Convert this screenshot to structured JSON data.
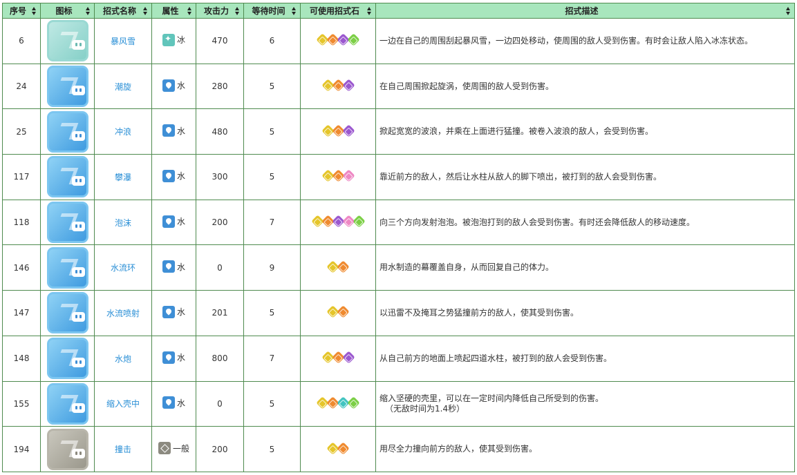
{
  "headers": [
    "序号",
    "图标",
    "招式名称",
    "属性",
    "攻击力",
    "等待时间",
    "可使用招式石",
    "招式描述"
  ],
  "rows": [
    {
      "id": "6",
      "name": "暴风雪",
      "attr": "冰",
      "attr_type": "ice",
      "attack": "470",
      "wait": "6",
      "stones": [
        "yellow",
        "orange",
        "purple",
        "green"
      ],
      "desc": "一边在自己的周围刮起暴风雪，一边四处移动，使周围的敌人受到伤害。有时会让敌人陷入冰冻状态。",
      "note": "",
      "icon": "ice-wave-icon"
    },
    {
      "id": "24",
      "name": "潮旋",
      "attr": "水",
      "attr_type": "water",
      "attack": "280",
      "wait": "5",
      "stones": [
        "yellow",
        "orange",
        "purple"
      ],
      "desc": "在自己周围掀起旋涡，使周围的敌人受到伤害。",
      "note": "",
      "icon": "whirlpool-icon"
    },
    {
      "id": "25",
      "name": "冲浪",
      "attr": "水",
      "attr_type": "water",
      "attack": "480",
      "wait": "5",
      "stones": [
        "yellow",
        "orange",
        "purple"
      ],
      "desc": "掀起宽宽的波浪，并乘在上面进行猛撞。被卷入波浪的敌人，会受到伤害。",
      "note": "",
      "icon": "surf-icon"
    },
    {
      "id": "117",
      "name": "攀瀑",
      "attr": "水",
      "attr_type": "water",
      "attack": "300",
      "wait": "5",
      "stones": [
        "yellow",
        "orange",
        "pink"
      ],
      "desc": "靠近前方的敌人，然后让水柱从敌人的脚下喷出，被打到的敌人会受到伤害。",
      "note": "",
      "icon": "waterfall-icon"
    },
    {
      "id": "118",
      "name": "泡沫",
      "attr": "水",
      "attr_type": "water",
      "attack": "200",
      "wait": "7",
      "stones": [
        "yellow",
        "orange",
        "purple",
        "pink",
        "green"
      ],
      "desc": "向三个方向发射泡泡。被泡泡打到的敌人会受到伤害。有时还会降低敌人的移动速度。",
      "note": "",
      "icon": "bubble-icon"
    },
    {
      "id": "146",
      "name": "水流环",
      "attr": "水",
      "attr_type": "water",
      "attack": "0",
      "wait": "9",
      "stones": [
        "yellow",
        "orange"
      ],
      "desc": "用水制造的幕覆盖自身，从而回复自己的体力。",
      "note": "",
      "icon": "aqua-ring-icon"
    },
    {
      "id": "147",
      "name": "水流喷射",
      "attr": "水",
      "attr_type": "water",
      "attack": "201",
      "wait": "5",
      "stones": [
        "yellow",
        "orange"
      ],
      "desc": "以迅雷不及掩耳之势猛撞前方的敌人，使其受到伤害。",
      "note": "",
      "icon": "aqua-jet-icon"
    },
    {
      "id": "148",
      "name": "水炮",
      "attr": "水",
      "attr_type": "water",
      "attack": "800",
      "wait": "7",
      "stones": [
        "yellow",
        "orange",
        "purple"
      ],
      "desc": "从自己前方的地面上喷起四道水柱，被打到的敌人会受到伤害。",
      "note": "",
      "icon": "hydro-pump-icon"
    },
    {
      "id": "155",
      "name": "缩入壳中",
      "attr": "水",
      "attr_type": "water",
      "attack": "0",
      "wait": "5",
      "stones": [
        "yellow",
        "orange",
        "cyan",
        "green"
      ],
      "desc": "缩入坚硬的壳里，可以在一定时间内降低自己所受到的伤害。",
      "note": "（无敌时间为1.4秒）",
      "icon": "withdraw-icon"
    },
    {
      "id": "194",
      "name": "撞击",
      "attr": "一般",
      "attr_type": "normal",
      "attack": "200",
      "wait": "5",
      "stones": [
        "yellow",
        "orange"
      ],
      "desc": "用尽全力撞向前方的敌人，使其受到伤害。",
      "note": "",
      "icon": "tackle-icon"
    }
  ]
}
